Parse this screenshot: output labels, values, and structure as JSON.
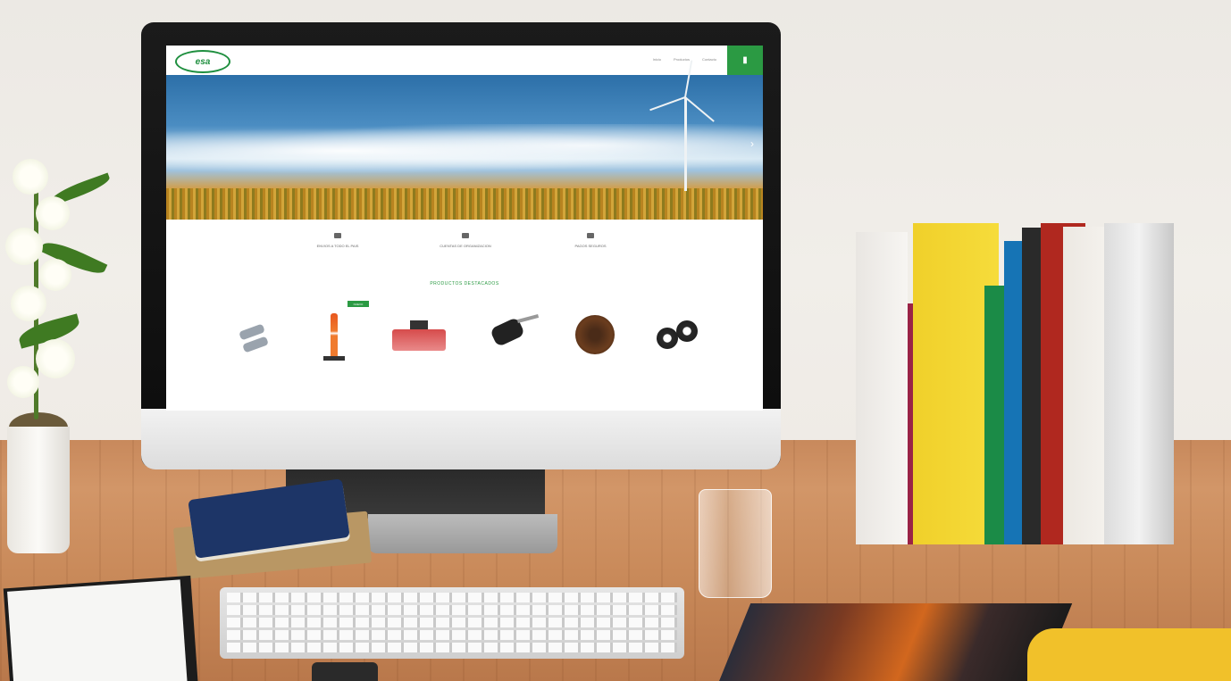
{
  "screen": {
    "logo_text": "esa",
    "nav_links": [
      "Inicio",
      "Productos",
      "Contacto"
    ],
    "cart_icon": "cart-icon",
    "features": [
      {
        "title": "ENVIOS A TODO EL PAIS"
      },
      {
        "title": "CUENTAS DE ORGANIZACION"
      },
      {
        "title": "PAGOS SEGUROS"
      }
    ],
    "section_title": "PRODUCTOS DESTACADOS",
    "badge_text": "NUEVO",
    "products": [
      {
        "name": "",
        "price": ""
      },
      {
        "name": "",
        "price": ""
      },
      {
        "name": "",
        "price": ""
      },
      {
        "name": "",
        "price": ""
      },
      {
        "name": "",
        "price": ""
      },
      {
        "name": "",
        "price": ""
      }
    ]
  },
  "colors": {
    "brand_green": "#2b9a43",
    "monitor_bezel": "#111111",
    "desk_wood": "#c8895c"
  }
}
